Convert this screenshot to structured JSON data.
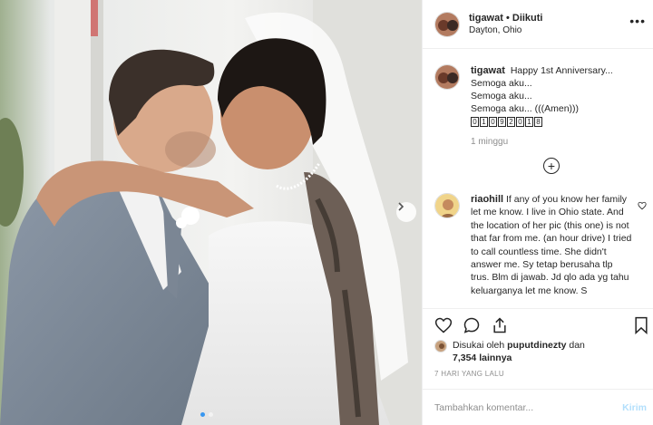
{
  "post": {
    "username": "tigawat",
    "follow_state": " • Diikuti",
    "location": "Dayton, Ohio"
  },
  "caption": {
    "username": "tigawat",
    "line1": "Happy 1st Anniversary...",
    "line2": "Semoga aku...",
    "line3": "Semoga aku...",
    "line4": "Semoga aku... (((Amen)))",
    "date_digits": [
      "0",
      "1",
      "0",
      "9",
      "2",
      "0",
      "1",
      "8"
    ],
    "time_ago": "1 minggu"
  },
  "comment": {
    "username": "riaohill",
    "text": "If any of you know her family let me know. I live in Ohio state. And the location of her pic (this one) is not that far from me. (an hour drive) I tried to call countless time. She didn't answer me. Sy tetap berusaha tlp trus. Blm di jawab. Jd qlo ada yg tahu keluarganya let me know. S"
  },
  "likes": {
    "prefix": "Disukai oleh",
    "user": "puputdinezty",
    "joiner": "dan",
    "count": "7,354 lainnya"
  },
  "posted_ago": "7 HARI YANG LALU",
  "add_comment": {
    "placeholder": "Tambahkan komentar...",
    "post_label": "Kirim"
  },
  "icons": {
    "more": "more-icon",
    "load_more": "plus-circle-icon",
    "like": "heart-icon",
    "comment": "comment-icon",
    "share": "share-icon",
    "save": "bookmark-icon",
    "next": "chevron-right-icon"
  },
  "colors": {
    "accent": "#3897f0",
    "post_disabled": "#b2dffc",
    "muted": "#8e8e8e",
    "text": "#262626"
  }
}
